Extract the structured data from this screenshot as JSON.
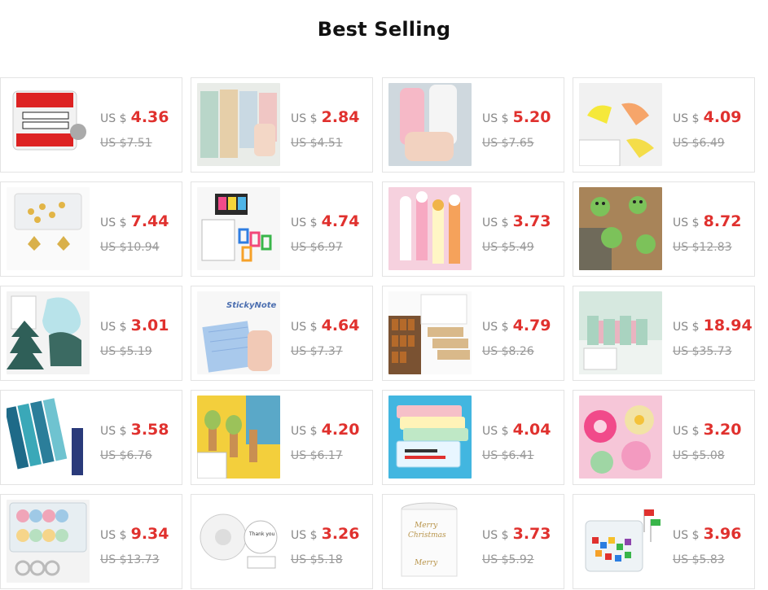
{
  "section": {
    "title": "Best Selling"
  },
  "currency_label": "US $",
  "colors": {
    "price": "#e0312e",
    "old_price": "#999999",
    "border": "#e3e3e3"
  },
  "products": [
    {
      "name": "service-due-sticker-roll",
      "icon": "label-roll-icon",
      "price": "4.36",
      "old_price": "US $7.51"
    },
    {
      "name": "sticky-note-tabs",
      "icon": "note-tabs-icon",
      "price": "2.84",
      "old_price": "US $4.51"
    },
    {
      "name": "pink-notebook",
      "icon": "notebook-icon",
      "price": "5.20",
      "old_price": "US $7.65"
    },
    {
      "name": "bookmark-clips",
      "icon": "clip-icon",
      "price": "4.09",
      "old_price": "US $6.49"
    },
    {
      "name": "antler-push-pins",
      "icon": "push-pin-icon",
      "price": "7.44",
      "old_price": "US $10.94"
    },
    {
      "name": "colorful-binder-clips",
      "icon": "binder-clip-icon",
      "price": "4.74",
      "old_price": "US $6.97"
    },
    {
      "name": "animal-ruler-bookmarks",
      "icon": "ruler-icon",
      "price": "3.73",
      "old_price": "US $5.49"
    },
    {
      "name": "frog-push-pins",
      "icon": "frog-icon",
      "price": "8.72",
      "old_price": "US $12.83"
    },
    {
      "name": "tree-shaped-sticky-notes",
      "icon": "tree-note-icon",
      "price": "3.01",
      "old_price": "US $5.19"
    },
    {
      "name": "sticky-note-pad",
      "icon": "note-pad-icon",
      "price": "4.64",
      "old_price": "US $7.37"
    },
    {
      "name": "spice-jar-labels",
      "icon": "jar-label-icon",
      "price": "4.79",
      "old_price": "US $8.26"
    },
    {
      "name": "alphabet-bookends",
      "icon": "bookend-icon",
      "price": "18.94",
      "old_price": "US $35.73"
    },
    {
      "name": "galaxy-magnetic-bookmarks",
      "icon": "bookmark-icon",
      "price": "3.58",
      "old_price": "US $6.76"
    },
    {
      "name": "avocado-wooden-clips",
      "icon": "wood-clip-icon",
      "price": "4.20",
      "old_price": "US $6.17"
    },
    {
      "name": "plastic-pencil-boxes",
      "icon": "pencil-box-icon",
      "price": "4.04",
      "old_price": "US $6.41"
    },
    {
      "name": "flower-tape-dispensers",
      "icon": "flower-icon",
      "price": "3.20",
      "old_price": "US $5.08"
    },
    {
      "name": "washi-tape-storage-box",
      "icon": "tape-box-icon",
      "price": "9.34",
      "old_price": "US $13.73"
    },
    {
      "name": "thank-you-sticker-roll",
      "icon": "round-label-icon",
      "price": "3.26",
      "old_price": "US $5.18"
    },
    {
      "name": "merry-christmas-labels",
      "icon": "gift-label-icon",
      "price": "3.73",
      "old_price": "US $5.92"
    },
    {
      "name": "flag-map-pins",
      "icon": "flag-pin-icon",
      "price": "3.96",
      "old_price": "US $5.83"
    }
  ]
}
